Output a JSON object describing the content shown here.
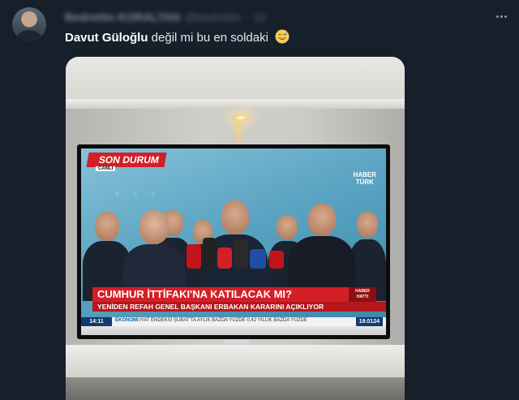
{
  "author": {
    "display_name": "Bedrettin KORALTAN",
    "handle": "@bedrettin",
    "time": "2s"
  },
  "tweet": {
    "mention": "Davut Güloğlu",
    "text": " değil mi bu en soldaki",
    "emoji_name": "grinning-face-with-sweat-emoji"
  },
  "media": {
    "tv": {
      "son_durum": "SON DURUM",
      "canli": "CANLI",
      "channel_logo_line1": "HABER",
      "channel_logo_line2": "TÜRK",
      "headline": "CUMHUR İTTİFAKI'NA KATILACAK MI?",
      "haber_hatti_1": "HABER",
      "haber_hatti_2": "HATTI",
      "subheadline": "YENİDEN REFAH GENEL BAŞKANI ERBAKAN KARARINI AÇIKLIYOR",
      "ticker_time": "14:11",
      "ticker_category": "EKONOMİ",
      "ticker_news": "İYAT ENDEKSİ ŞUBAT'TA AYLIK BAZDA YÜZDE 0,42 YILLIK BAZDA YÜZDE",
      "ticker_price": "19.0124"
    }
  },
  "colors": {
    "background": "#15202b",
    "banner_red": "#d41f26",
    "ticker_blue": "#123a6e"
  }
}
